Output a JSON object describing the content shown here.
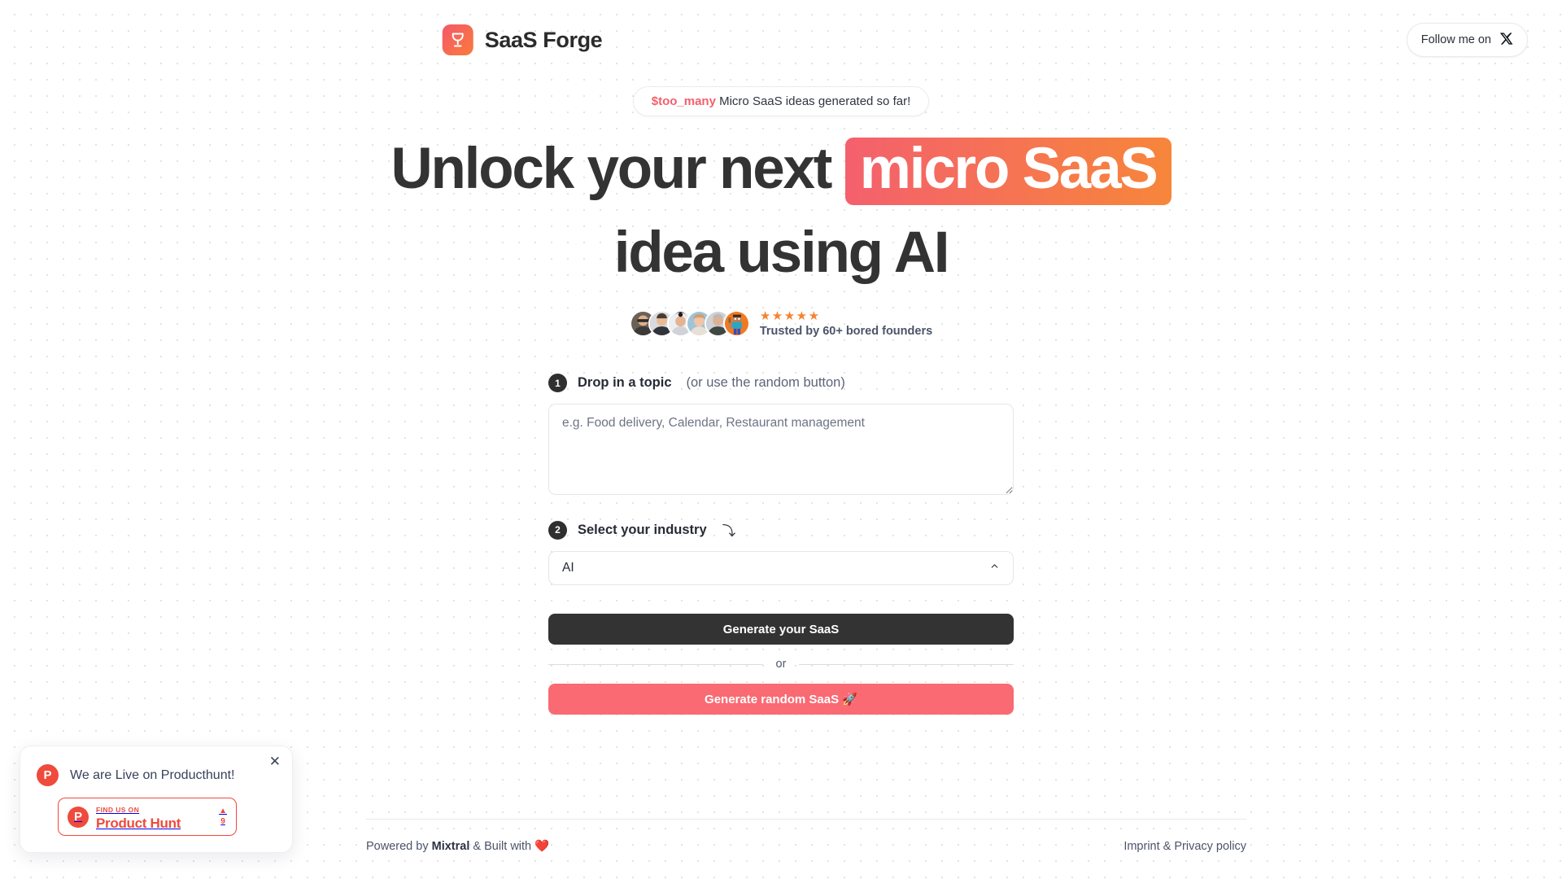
{
  "header": {
    "brand_name": "SaaS Forge",
    "brand_logo_icon": "anvil-forge-icon",
    "follow_label": "Follow me on",
    "follow_icon": "x-twitter-icon"
  },
  "hero": {
    "counter_value": "$too_many",
    "counter_text": "Micro SaaS ideas generated so far!",
    "headline_part1": "Unlock your next",
    "headline_highlight": "micro SaaS",
    "headline_part2": "idea using AI",
    "highlight_gradient_from": "#f4606d",
    "highlight_gradient_to": "#f7863a"
  },
  "social_proof": {
    "stars": "★★★★★",
    "star_color": "#f5832e",
    "label": "Trusted by 60+ bored founders",
    "avatar_count": 6,
    "avatars": [
      "avatar-founder-1",
      "avatar-founder-2",
      "avatar-founder-3",
      "avatar-founder-4",
      "avatar-founder-5",
      "avatar-minecraft-steve"
    ]
  },
  "form": {
    "step1": {
      "number": "1",
      "label": "Drop in a topic",
      "hint": "(or use the random button)"
    },
    "topic_placeholder": "e.g. Food delivery, Calendar, Restaurant management",
    "topic_value": "",
    "step2": {
      "number": "2",
      "label": "Select your industry",
      "arrow": "⤵"
    },
    "industry_selected": "AI",
    "industry_chevron_icon": "chevron-up-icon",
    "generate_label": "Generate your SaaS",
    "or_label": "or",
    "random_label": "Generate random SaaS 🚀",
    "primary_button_color": "#333333",
    "random_button_color": "#f96a72"
  },
  "footer": {
    "powered_prefix": "Powered by ",
    "powered_brand": "Mixtral",
    "powered_suffix": " & Built with ❤️",
    "legal_link": "Imprint & Privacy policy"
  },
  "product_hunt": {
    "close_icon": "close-icon",
    "logo_letter": "P",
    "title": "We are Live on Producthunt!",
    "badge_kicker": "FIND US ON",
    "badge_name": "Product Hunt",
    "badge_caret": "▲",
    "badge_votes": "9",
    "accent_color": "#ef4a3c"
  }
}
